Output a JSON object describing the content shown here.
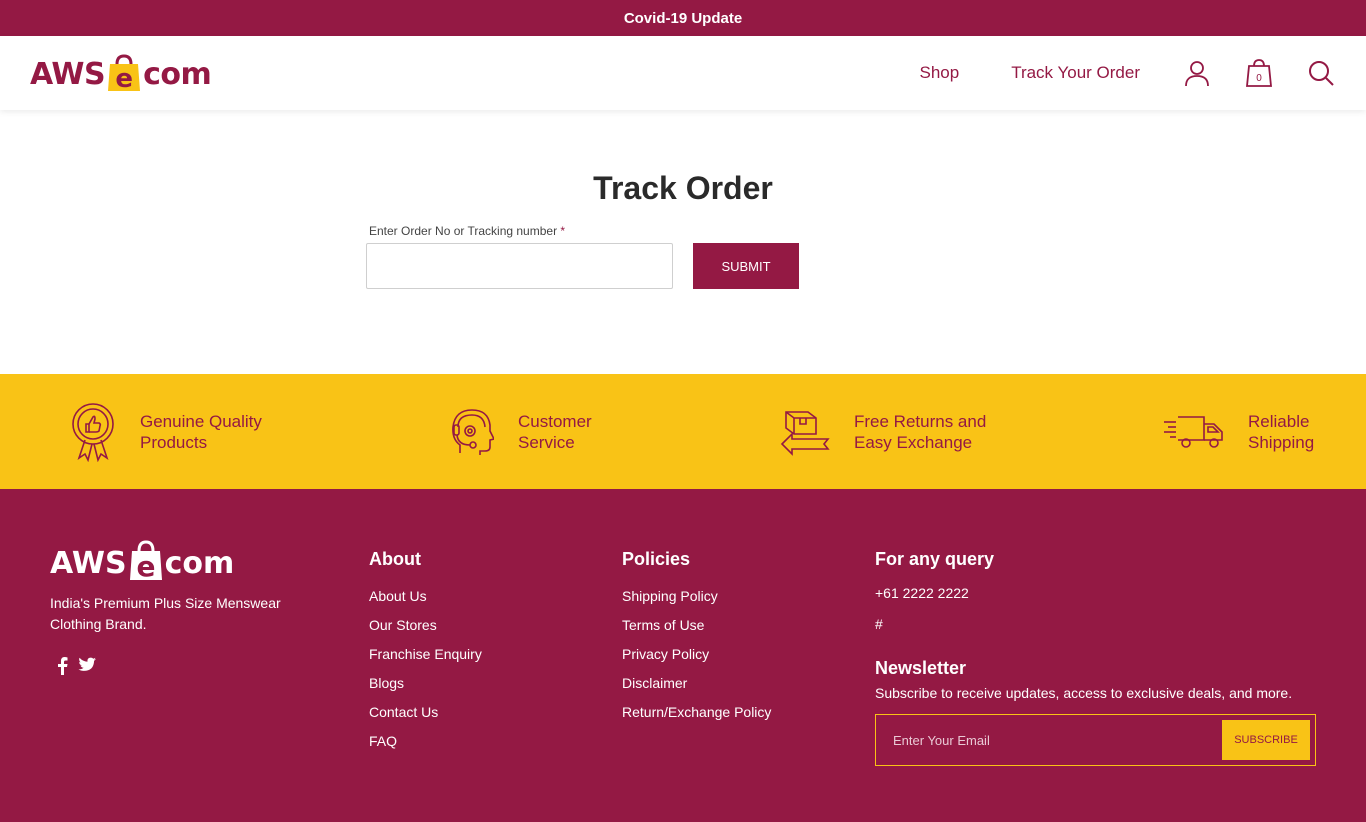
{
  "topbar": {
    "text": "Covid-19 Update"
  },
  "header": {
    "logo": {
      "pre": "AWS",
      "mid": "e",
      "post": "com"
    },
    "nav": {
      "shop": "Shop",
      "track": "Track Your Order"
    },
    "cart_count": "0"
  },
  "main": {
    "title": "Track Order",
    "field_label": "Enter Order No or Tracking number",
    "required_mark": "*",
    "input_value": "",
    "submit_label": "SUBMIT"
  },
  "features": [
    {
      "line1": "Genuine Quality",
      "line2": "Products",
      "icon": "ribbon-thumbs-up-icon"
    },
    {
      "line1": "Customer",
      "line2": "Service",
      "icon": "headset-icon"
    },
    {
      "line1": "Free Returns and",
      "line2": "Easy Exchange",
      "icon": "return-box-icon"
    },
    {
      "line1": "Reliable",
      "line2": "Shipping",
      "icon": "delivery-truck-icon"
    }
  ],
  "footer": {
    "logo": {
      "pre": "AWS",
      "mid": "e",
      "post": "com"
    },
    "tagline": "India's Premium Plus Size Menswear Clothing Brand.",
    "social": [
      "facebook-icon",
      "twitter-icon"
    ],
    "about": {
      "title": "About",
      "links": [
        "About Us",
        "Our Stores",
        "Franchise Enquiry",
        "Blogs",
        "Contact Us",
        "FAQ"
      ]
    },
    "policies": {
      "title": "Policies",
      "links": [
        "Shipping Policy",
        "Terms of Use",
        "Privacy Policy",
        "Disclaimer",
        "Return/Exchange Policy"
      ]
    },
    "query": {
      "title": "For any query",
      "phone": "+61 2222 2222",
      "email": "#"
    },
    "newsletter": {
      "title": "Newsletter",
      "subtitle": "Subscribe to receive updates, access to exclusive deals, and more.",
      "placeholder": "Enter Your Email",
      "button": "SUBSCRIBE"
    }
  },
  "colors": {
    "brand": "#941944",
    "accent": "#f9c316"
  }
}
